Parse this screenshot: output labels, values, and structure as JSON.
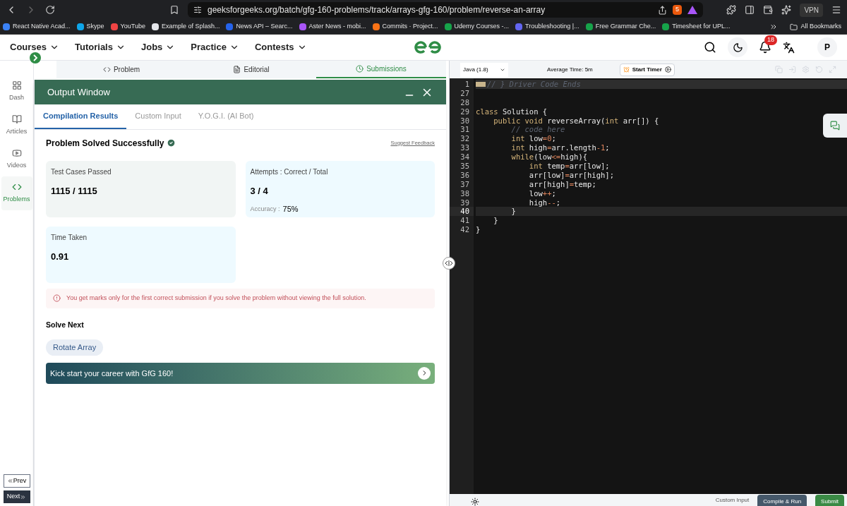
{
  "browser": {
    "url": "geeksforgeeks.org/batch/gfg-160-problems/track/arrays-gfg-160/problem/reverse-an-array",
    "shield_count": "5",
    "vpn": "VPN"
  },
  "bookmarks": [
    "React Native Acad...",
    "Skype",
    "YouTube",
    "Example of Splash...",
    "News API – Searc...",
    "Aster News - mobi...",
    "Commits · Project...",
    "Udemy Courses -...",
    "Troubleshooting |...",
    "Free Grammar Che...",
    "Timesheet for UPL..."
  ],
  "all_bookmarks": "All Bookmarks",
  "nav": {
    "menus": [
      "Courses",
      "Tutorials",
      "Jobs",
      "Practice",
      "Contests"
    ],
    "notifications": "18",
    "avatar": "P"
  },
  "problem_tabs": [
    {
      "label": "Problem",
      "selected": false
    },
    {
      "label": "Editorial",
      "selected": false
    },
    {
      "label": "Submissions",
      "selected": true
    }
  ],
  "sidebar": [
    {
      "label": "Dash",
      "selected": false
    },
    {
      "label": "Articles",
      "selected": false
    },
    {
      "label": "Videos",
      "selected": false
    },
    {
      "label": "Problems",
      "selected": true
    }
  ],
  "pager": [
    "Prev",
    "Next"
  ],
  "output_window": {
    "title": "Output Window",
    "tabs": [
      {
        "label": "Compilation Results",
        "selected": true
      },
      {
        "label": "Custom Input",
        "selected": false
      },
      {
        "label": "Y.O.G.I. (AI Bot)",
        "selected": false
      }
    ],
    "status": "Problem Solved Successfully",
    "feedback": "Suggest Feedback",
    "cards": [
      {
        "label": "Test Cases Passed",
        "value": "1115 / 1115"
      },
      {
        "label": "Attempts : Correct / Total",
        "value": "3 / 4",
        "sub_label": "Accuracy :",
        "sub_value": "75%"
      },
      {
        "label": "Time Taken",
        "value": "0.91"
      }
    ],
    "notice": "You get marks only for the first correct submission if you solve the problem without viewing the full solution.",
    "solve_next": "Solve Next",
    "next_problems": [
      "Rotate Array"
    ],
    "banner": "Kick start your career with GfG 160!"
  },
  "editor": {
    "language": "Java (1.8)",
    "average_time": "Average Time: 5m",
    "timer": "Start Timer",
    "lines": [
      {
        "number": "1",
        "active": false,
        "tokens": [
          {
            "kind": "comment",
            "text": "// } Driver Code Ends"
          }
        ]
      },
      {
        "number": "27",
        "active": false
      },
      {
        "number": "28",
        "active": false
      },
      {
        "number": "29",
        "active": false,
        "tokens": [
          {
            "kind": "keyword",
            "text": "class"
          },
          {
            "kind": "plain",
            "text": " Solution {"
          }
        ]
      },
      {
        "number": "30",
        "active": false,
        "tokens": [
          {
            "kind": "keyword",
            "text": "    public void"
          },
          {
            "kind": "plain",
            "text": " reverseArray("
          },
          {
            "kind": "keyword",
            "text": "int"
          },
          {
            "kind": "plain",
            "text": " arr[]) {"
          }
        ]
      },
      {
        "number": "31",
        "active": false,
        "tokens": [
          {
            "kind": "comment",
            "text": "        // code here"
          }
        ]
      },
      {
        "number": "32",
        "active": false,
        "tokens": [
          {
            "kind": "keyword",
            "text": "        int"
          },
          {
            "kind": "plain",
            "text": " low"
          },
          {
            "kind": "operator",
            "text": "=0"
          },
          {
            "kind": "plain",
            "text": ";"
          }
        ]
      },
      {
        "number": "33",
        "active": false,
        "tokens": [
          {
            "kind": "keyword",
            "text": "        int"
          },
          {
            "kind": "plain",
            "text": " high"
          },
          {
            "kind": "operator",
            "text": "="
          },
          {
            "kind": "plain",
            "text": "arr.length"
          },
          {
            "kind": "operator",
            "text": "-1"
          },
          {
            "kind": "plain",
            "text": ";"
          }
        ]
      },
      {
        "number": "34",
        "active": false,
        "tokens": [
          {
            "kind": "keyword",
            "text": "        while"
          },
          {
            "kind": "plain",
            "text": "(low"
          },
          {
            "kind": "operator",
            "text": "<="
          },
          {
            "kind": "plain",
            "text": "high){"
          }
        ]
      },
      {
        "number": "35",
        "active": false,
        "tokens": [
          {
            "kind": "keyword",
            "text": "            int"
          },
          {
            "kind": "plain",
            "text": " temp"
          },
          {
            "kind": "operator",
            "text": "="
          },
          {
            "kind": "plain",
            "text": "arr[low];"
          }
        ]
      },
      {
        "number": "36",
        "active": false,
        "tokens": [
          {
            "kind": "plain",
            "text": "            arr[low]"
          },
          {
            "kind": "operator",
            "text": "="
          },
          {
            "kind": "plain",
            "text": "arr[high];"
          }
        ]
      },
      {
        "number": "37",
        "active": false,
        "tokens": [
          {
            "kind": "plain",
            "text": "            arr[high]"
          },
          {
            "kind": "operator",
            "text": "="
          },
          {
            "kind": "plain",
            "text": "temp;"
          }
        ]
      },
      {
        "number": "38",
        "active": false,
        "tokens": [
          {
            "kind": "plain",
            "text": "            low"
          },
          {
            "kind": "operator",
            "text": "++"
          },
          {
            "kind": "plain",
            "text": ";"
          }
        ]
      },
      {
        "number": "39",
        "active": false,
        "tokens": [
          {
            "kind": "plain",
            "text": "            high"
          },
          {
            "kind": "operator",
            "text": "--"
          },
          {
            "kind": "plain",
            "text": ";"
          }
        ]
      },
      {
        "number": "40",
        "active": true,
        "tokens": [
          {
            "kind": "plain",
            "text": "        }"
          }
        ]
      },
      {
        "number": "41",
        "active": false,
        "tokens": [
          {
            "kind": "plain",
            "text": "    }"
          }
        ]
      },
      {
        "number": "42",
        "active": false,
        "tokens": [
          {
            "kind": "plain",
            "text": "}"
          }
        ]
      }
    ],
    "footer": {
      "custom_input": "Custom Input",
      "compile": "Compile & Run",
      "submit": "Submit"
    }
  }
}
